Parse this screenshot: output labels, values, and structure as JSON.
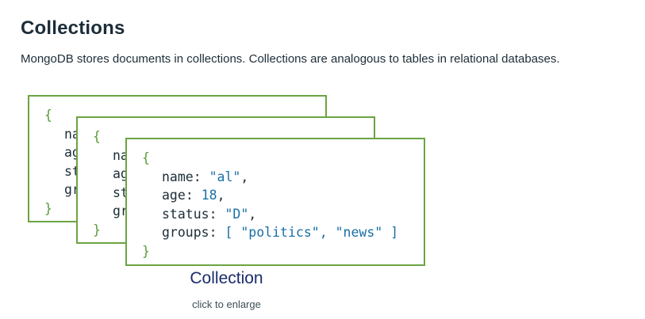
{
  "page": {
    "title": "Collections",
    "intro": "MongoDB stores documents in collections. Collections are analogous to tables in relational databases."
  },
  "figure": {
    "caption": "Collection",
    "hint": "click to enlarge",
    "colors": {
      "card_border": "#6ba442",
      "brace": "#5a9a36",
      "value": "#1a6fa5",
      "caption": "#1a2c6b"
    },
    "back_card": {
      "open_brace": "{",
      "close_brace": "}",
      "lines": [
        "na",
        "ag",
        "st",
        "gr"
      ]
    },
    "middle_card": {
      "open_brace": "{",
      "close_brace": "}",
      "lines": [
        "na",
        "ag",
        "st",
        "gr"
      ]
    },
    "front_card": {
      "open_brace": "{",
      "close_brace": "}",
      "fields": {
        "name_key": "name",
        "name_value": "\"al\"",
        "age_key": "age",
        "age_value": "18",
        "status_key": "status",
        "status_value": "\"D\"",
        "groups_key": "groups",
        "groups_open": "[",
        "groups_item1": "\"politics\"",
        "groups_item2": "\"news\"",
        "groups_close": "]"
      }
    }
  }
}
